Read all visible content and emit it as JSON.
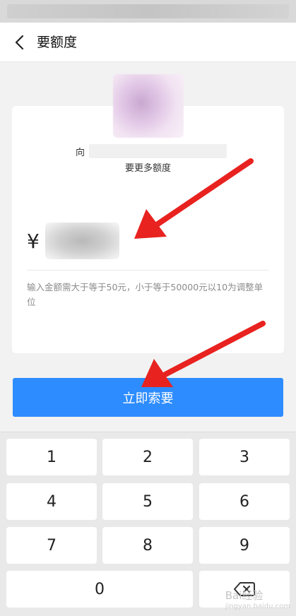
{
  "header": {
    "title": "要额度",
    "back_icon": "chevron-left-icon"
  },
  "card": {
    "to_prefix": "向",
    "subtitle": "要更多额度",
    "currency": "¥",
    "hint": "输入金额需大于等于50元，小于等于50000元以10为调整单位"
  },
  "submit": {
    "label": "立即索要",
    "color": "#2d8cff"
  },
  "keypad": {
    "keys": [
      "1",
      "2",
      "3",
      "4",
      "5",
      "6",
      "7",
      "8",
      "9",
      "0"
    ],
    "delete_icon": "backspace-icon"
  },
  "watermark": {
    "text": "Bai经验",
    "url": "jingyan.baidu.com"
  },
  "annotation": {
    "arrow_color": "#e8221f"
  }
}
